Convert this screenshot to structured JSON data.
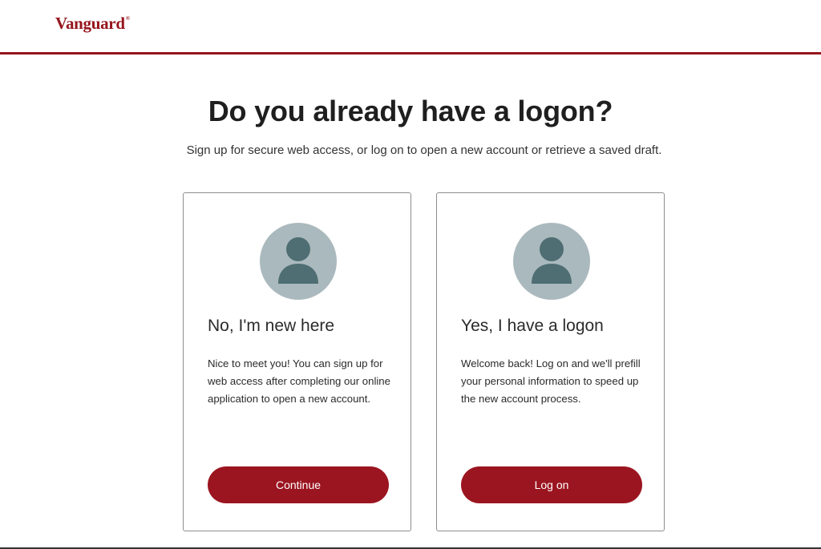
{
  "header": {
    "logo_text": "Vanguard",
    "logo_mark": "®",
    "accent_color": "#96151d"
  },
  "main": {
    "title": "Do you already have a logon?",
    "subtitle": "Sign up for secure web access, or log on to open a new account or retrieve a saved draft."
  },
  "cards": [
    {
      "icon": "user-avatar-icon",
      "heading": "No, I'm new here",
      "body": "Nice to meet you! You can sign up for web access after completing our online application to open a new account.",
      "button_label": "Continue"
    },
    {
      "icon": "user-avatar-icon",
      "heading": "Yes, I have a logon",
      "body": "Welcome back! Log on and we'll prefill your personal information to speed up the new account process.",
      "button_label": "Log on"
    }
  ],
  "colors": {
    "button": "#9b1520",
    "avatar_bg": "#aab9bd",
    "avatar_fg": "#4f6e73"
  }
}
